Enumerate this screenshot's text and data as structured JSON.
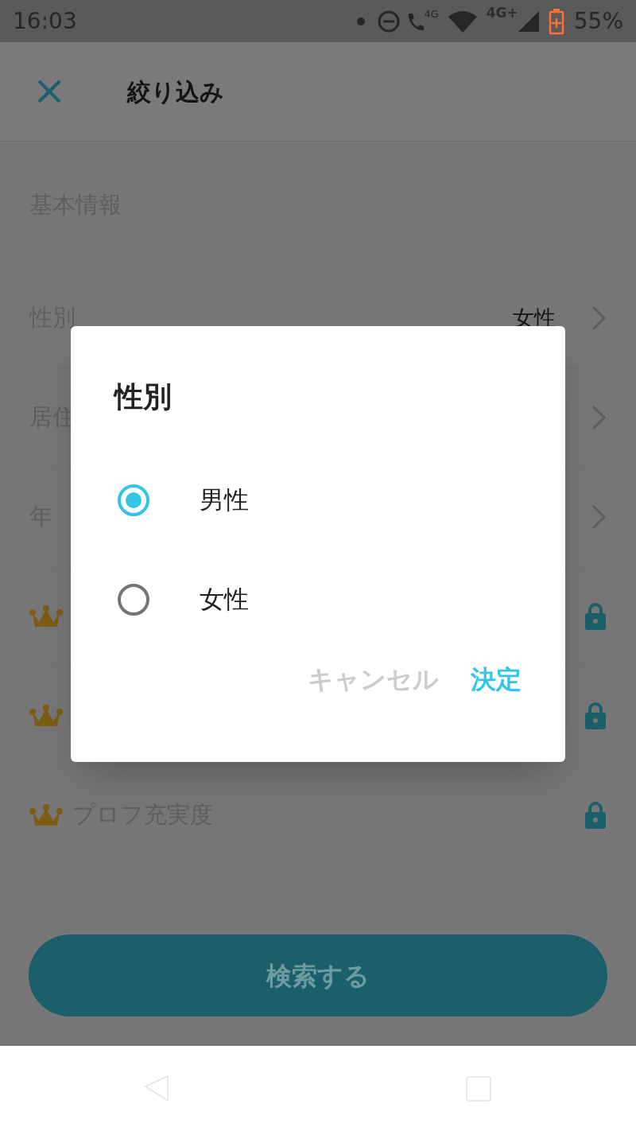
{
  "status_bar": {
    "time": "16:03",
    "call_network": "4G",
    "mobile_network": "4G+",
    "battery": "55%"
  },
  "header": {
    "title": "絞り込み"
  },
  "section_title": "基本情報",
  "rows": [
    {
      "kind": "select",
      "label": "性別",
      "value": "女性"
    },
    {
      "kind": "select",
      "label": "居住"
    },
    {
      "kind": "select",
      "label": "年"
    },
    {
      "kind": "premium"
    },
    {
      "kind": "premium"
    },
    {
      "kind": "premium",
      "label": "プロフ充実度"
    }
  ],
  "search_button": "検索する",
  "dialog": {
    "title": "性別",
    "options": [
      {
        "label": "男性",
        "selected": true
      },
      {
        "label": "女性",
        "selected": false
      }
    ],
    "buttons": [
      {
        "kind": "cancel",
        "label": "キャンセル"
      },
      {
        "kind": "confirm",
        "label": "決定"
      }
    ]
  }
}
